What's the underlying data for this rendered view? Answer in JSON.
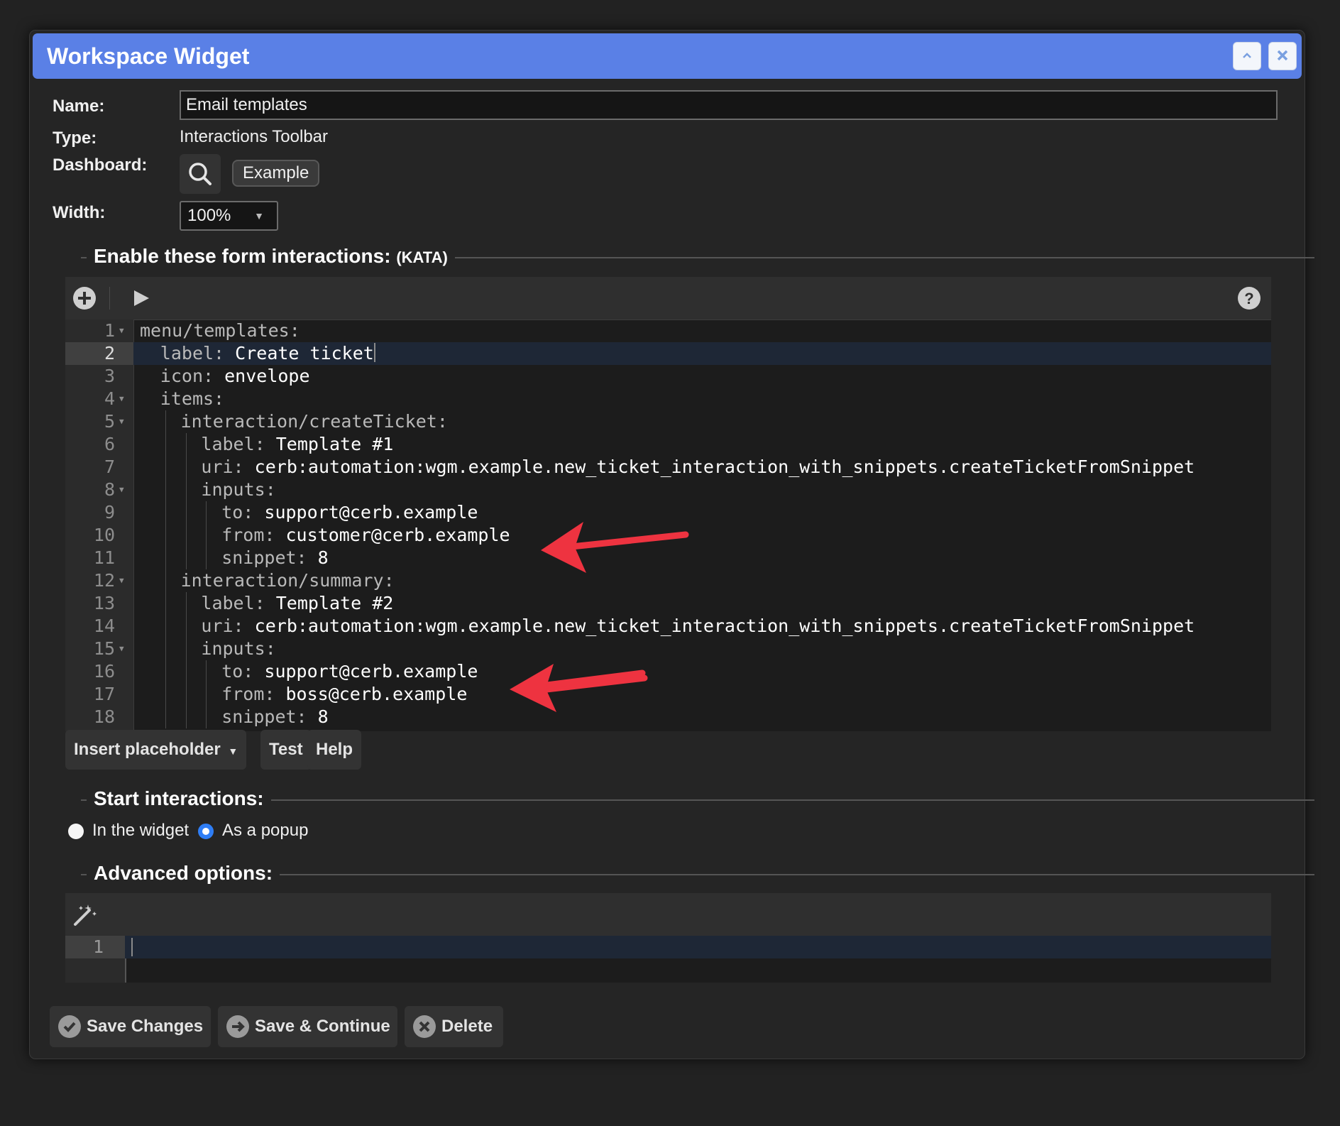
{
  "window": {
    "title": "Workspace Widget"
  },
  "form": {
    "name_label": "Name:",
    "name_value": "Email templates",
    "type_label": "Type:",
    "type_value": "Interactions Toolbar",
    "dashboard_label": "Dashboard:",
    "dashboard_value": "Example",
    "width_label": "Width:",
    "width_value": "100%"
  },
  "interactions_section": {
    "title": "Enable these form interactions:",
    "subtitle": "(KATA)"
  },
  "code_lines": [
    {
      "n": "1",
      "fold": true,
      "indent": 0,
      "key": "menu/templates:",
      "val": ""
    },
    {
      "n": "2",
      "fold": false,
      "indent": 1,
      "key": "label:",
      "val": " Create ticket",
      "active": true
    },
    {
      "n": "3",
      "fold": false,
      "indent": 1,
      "key": "icon:",
      "val": " envelope"
    },
    {
      "n": "4",
      "fold": true,
      "indent": 1,
      "key": "items:",
      "val": ""
    },
    {
      "n": "5",
      "fold": true,
      "indent": 2,
      "key": "interaction/createTicket:",
      "val": ""
    },
    {
      "n": "6",
      "fold": false,
      "indent": 3,
      "key": "label:",
      "val": " Template #1"
    },
    {
      "n": "7",
      "fold": false,
      "indent": 3,
      "key": "uri:",
      "val": " cerb:automation:wgm.example.new_ticket_interaction_with_snippets.createTicketFromSnippet"
    },
    {
      "n": "8",
      "fold": true,
      "indent": 3,
      "key": "inputs:",
      "val": ""
    },
    {
      "n": "9",
      "fold": false,
      "indent": 4,
      "key": "to:",
      "val": " support@cerb.example"
    },
    {
      "n": "10",
      "fold": false,
      "indent": 4,
      "key": "from:",
      "val": " customer@cerb.example"
    },
    {
      "n": "11",
      "fold": false,
      "indent": 4,
      "key": "snippet:",
      "val": " 8"
    },
    {
      "n": "12",
      "fold": true,
      "indent": 2,
      "key": "interaction/summary:",
      "val": ""
    },
    {
      "n": "13",
      "fold": false,
      "indent": 3,
      "key": "label:",
      "val": " Template #2"
    },
    {
      "n": "14",
      "fold": false,
      "indent": 3,
      "key": "uri:",
      "val": " cerb:automation:wgm.example.new_ticket_interaction_with_snippets.createTicketFromSnippet"
    },
    {
      "n": "15",
      "fold": true,
      "indent": 3,
      "key": "inputs:",
      "val": ""
    },
    {
      "n": "16",
      "fold": false,
      "indent": 4,
      "key": "to:",
      "val": " support@cerb.example"
    },
    {
      "n": "17",
      "fold": false,
      "indent": 4,
      "key": "from:",
      "val": " boss@cerb.example"
    },
    {
      "n": "18",
      "fold": false,
      "indent": 4,
      "key": "snippet:",
      "val": " 8"
    }
  ],
  "editor_buttons": {
    "insert_placeholder": "Insert placeholder",
    "test": "Test",
    "help": "Help"
  },
  "start_section": {
    "title": "Start interactions:",
    "option_widget": "In the widget",
    "option_popup": "As a popup",
    "selected": "As a popup"
  },
  "advanced_section": {
    "title": "Advanced options:",
    "line_number": "1"
  },
  "footer": {
    "save_changes": "Save Changes",
    "save_continue": "Save & Continue",
    "delete": "Delete"
  },
  "colors": {
    "titlebar": "#5a80e6",
    "radio_selected": "#2f7ef6",
    "annotation_arrow": "#ee3340"
  },
  "icons": [
    "chevron-up-icon",
    "close-icon",
    "search-icon",
    "plus-circle-icon",
    "play-icon",
    "help-circle-icon",
    "magic-wand-icon",
    "checkmark-icon",
    "arrow-right-icon",
    "x-circle-icon",
    "red-arrow-annotation"
  ]
}
